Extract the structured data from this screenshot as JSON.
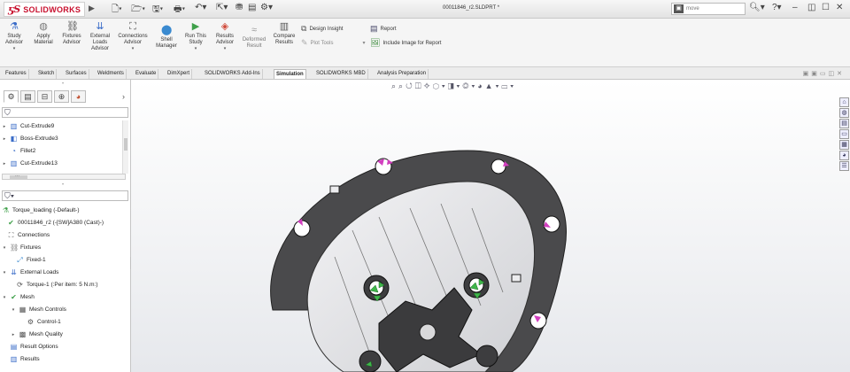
{
  "app": {
    "brand": "SOLIDWORKS",
    "document_title": "00011846_r2.SLDPRT *",
    "search_value": "move"
  },
  "ribbon": {
    "buttons": [
      {
        "label": "Study Advisor",
        "icon": "study-advisor-icon"
      },
      {
        "label": "Apply Material",
        "icon": "apply-material-icon"
      },
      {
        "label": "Fixtures Advisor",
        "icon": "fixtures-icon"
      },
      {
        "label": "External Loads Advisor",
        "icon": "external-loads-icon"
      },
      {
        "label": "Connections Advisor",
        "icon": "connections-icon"
      },
      {
        "label": "Shell Manager",
        "icon": "shell-manager-icon"
      },
      {
        "label": "Run This Study",
        "icon": "run-study-icon"
      },
      {
        "label": "Results Advisor",
        "icon": "results-advisor-icon"
      },
      {
        "label": "Deformed Result",
        "icon": "deformed-result-icon"
      },
      {
        "label": "Compare Results",
        "icon": "compare-results-icon"
      }
    ],
    "design_insight": "Design Insight",
    "plot_tools": "Plot Tools",
    "report": "Report",
    "include_image": "Include Image for Report"
  },
  "tabs": [
    "Features",
    "Sketch",
    "Surfaces",
    "Weldments",
    "Evaluate",
    "DimXpert",
    "SOLIDWORKS Add-Ins",
    "Simulation",
    "SOLIDWORKS MBD",
    "Analysis Preparation"
  ],
  "active_tab": "Simulation",
  "feature_tree": [
    {
      "label": "Cut-Extrude9",
      "icon": "cut-extrude-icon"
    },
    {
      "label": "Boss-Extrude3",
      "icon": "boss-extrude-icon"
    },
    {
      "label": "Fillet2",
      "icon": "fillet-icon"
    },
    {
      "label": "Cut-Extrude13",
      "icon": "cut-extrude-icon"
    },
    {
      "label": "...",
      "icon": ""
    }
  ],
  "study_tree": [
    {
      "label": "Torque_loading (-Default-)",
      "icon": "study-icon",
      "level": 0
    },
    {
      "label": "00011846_r2 (-[SW]A380 (Cast)-)",
      "icon": "part-icon",
      "level": 1
    },
    {
      "label": "Connections",
      "icon": "connections-icon",
      "level": 1
    },
    {
      "label": "Fixtures",
      "icon": "fixtures-icon",
      "level": 1
    },
    {
      "label": "Fixed-1",
      "icon": "fixed-icon",
      "level": 2
    },
    {
      "label": "External Loads",
      "icon": "external-loads-icon",
      "level": 1
    },
    {
      "label": "Torque-1 (:Per item: 5 N.m:)",
      "icon": "torque-icon",
      "level": 2
    },
    {
      "label": "Mesh",
      "icon": "mesh-icon",
      "level": 1
    },
    {
      "label": "Mesh Controls",
      "icon": "mesh-controls-icon",
      "level": 2
    },
    {
      "label": "Control-1",
      "icon": "control-icon",
      "level": 3
    },
    {
      "label": "Mesh Quality",
      "icon": "mesh-quality-icon",
      "level": 2
    },
    {
      "label": "Result Options",
      "icon": "result-options-icon",
      "level": 1
    },
    {
      "label": "Results",
      "icon": "results-icon",
      "level": 1
    }
  ],
  "colors": {
    "brand_red": "#c8102e",
    "part_dark": "#4a4a4c",
    "part_light": "#e4e4e6",
    "fixture_green": "#3fb64a",
    "load_magenta": "#d23fbf"
  }
}
